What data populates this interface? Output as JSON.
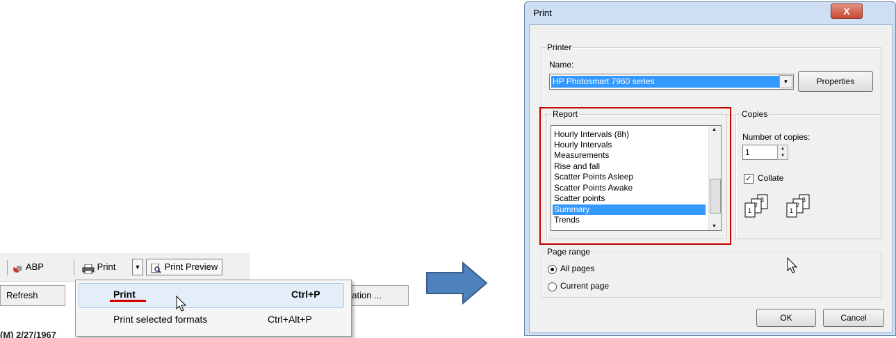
{
  "toolbar": {
    "abp_label": "ABP",
    "print_label": "Print",
    "print_preview_label": "Print Preview",
    "refresh_label": "Refresh",
    "information_label": "nation ..."
  },
  "context_menu": {
    "items": [
      {
        "label": "Print",
        "shortcut": "Ctrl+P"
      },
      {
        "label": "Print selected formats",
        "shortcut": "Ctrl+Alt+P"
      }
    ]
  },
  "background_text": "(M)   2/27/1967",
  "dialog": {
    "title": "Print",
    "close_label": "X",
    "printer": {
      "group_label": "Printer",
      "name_label": "Name:",
      "name_value": "HP Photosmart 7960 series",
      "properties_label": "Properties"
    },
    "report": {
      "group_label": "Report",
      "items": [
        "Hourly Intervals (8h)",
        "Hourly Intervals",
        "Measurements",
        "Rise and fall",
        "Scatter Points Asleep",
        "Scatter Points Awake",
        "Scatter points",
        "Summary",
        "Trends"
      ],
      "selected": "Summary"
    },
    "copies": {
      "group_label": "Copies",
      "number_label": "Number of copies:",
      "number_value": "1",
      "collate_label": "Collate",
      "collate_checked": true
    },
    "page_range": {
      "group_label": "Page range",
      "all_pages_label": "All pages",
      "current_page_label": "Current page",
      "selected": "All pages"
    },
    "ok_label": "OK",
    "cancel_label": "Cancel"
  },
  "colors": {
    "selection": "#3399ff",
    "highlight_box": "#c00000",
    "arrow": "#4f81bd",
    "underline": "#d40000"
  }
}
